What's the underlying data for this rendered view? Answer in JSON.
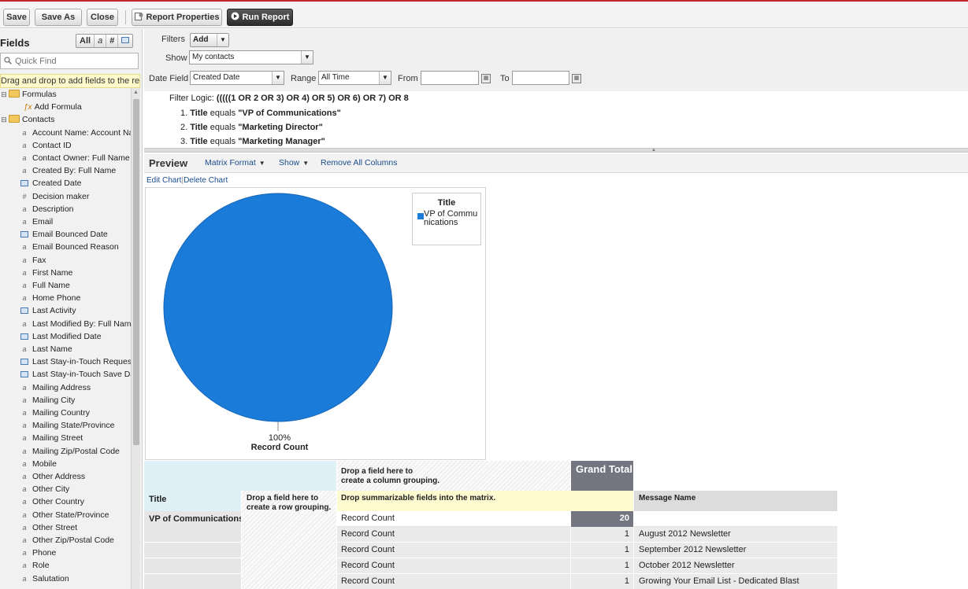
{
  "toolbar": {
    "save": "Save",
    "save_as": "Save As",
    "close": "Close",
    "report_properties": "Report Properties",
    "run_report": "Run Report"
  },
  "fields_panel": {
    "title": "Fields",
    "type_filters": [
      "All",
      "a",
      "#",
      "cal"
    ],
    "quick_find_placeholder": "Quick Find",
    "drag_hint": "Drag and drop to add fields to the report.",
    "tree": [
      {
        "kind": "folder",
        "label": "Formulas",
        "toggle": "⊟"
      },
      {
        "kind": "formula",
        "label": "Add Formula"
      },
      {
        "kind": "folder",
        "label": "Contacts",
        "toggle": "⊟"
      },
      {
        "kind": "text",
        "label": "Account Name: Account Nar"
      },
      {
        "kind": "text",
        "label": "Contact ID"
      },
      {
        "kind": "text",
        "label": "Contact Owner: Full Name"
      },
      {
        "kind": "text",
        "label": "Created By: Full Name"
      },
      {
        "kind": "date",
        "label": "Created Date"
      },
      {
        "kind": "number",
        "label": "Decision maker"
      },
      {
        "kind": "text",
        "label": "Description"
      },
      {
        "kind": "text",
        "label": "Email"
      },
      {
        "kind": "date",
        "label": "Email Bounced Date"
      },
      {
        "kind": "text",
        "label": "Email Bounced Reason"
      },
      {
        "kind": "text",
        "label": "Fax"
      },
      {
        "kind": "text",
        "label": "First Name"
      },
      {
        "kind": "text",
        "label": "Full Name"
      },
      {
        "kind": "text",
        "label": "Home Phone"
      },
      {
        "kind": "date",
        "label": "Last Activity"
      },
      {
        "kind": "text",
        "label": "Last Modified By: Full Name"
      },
      {
        "kind": "date",
        "label": "Last Modified Date"
      },
      {
        "kind": "text",
        "label": "Last Name"
      },
      {
        "kind": "date",
        "label": "Last Stay-in-Touch Request"
      },
      {
        "kind": "date",
        "label": "Last Stay-in-Touch Save Dat"
      },
      {
        "kind": "text",
        "label": "Mailing Address"
      },
      {
        "kind": "text",
        "label": "Mailing City"
      },
      {
        "kind": "text",
        "label": "Mailing Country"
      },
      {
        "kind": "text",
        "label": "Mailing State/Province"
      },
      {
        "kind": "text",
        "label": "Mailing Street"
      },
      {
        "kind": "text",
        "label": "Mailing Zip/Postal Code"
      },
      {
        "kind": "text",
        "label": "Mobile"
      },
      {
        "kind": "text",
        "label": "Other Address"
      },
      {
        "kind": "text",
        "label": "Other City"
      },
      {
        "kind": "text",
        "label": "Other Country"
      },
      {
        "kind": "text",
        "label": "Other State/Province"
      },
      {
        "kind": "text",
        "label": "Other Street"
      },
      {
        "kind": "text",
        "label": "Other Zip/Postal Code"
      },
      {
        "kind": "text",
        "label": "Phone"
      },
      {
        "kind": "text",
        "label": "Role"
      },
      {
        "kind": "text",
        "label": "Salutation"
      }
    ]
  },
  "filters": {
    "filters_label": "Filters",
    "add_label": "Add",
    "show_label": "Show",
    "show_value": "My contacts",
    "date_field_label": "Date Field",
    "date_field_value": "Created Date",
    "range_label": "Range",
    "range_value": "All Time",
    "from_label": "From",
    "from_value": "",
    "to_label": "To",
    "to_value": "",
    "filter_logic_label": "Filter Logic:",
    "filter_logic_value": "(((((1 OR 2 OR 3) OR 4) OR 5) OR 6) OR 7) OR 8",
    "conditions": [
      {
        "num": "1.",
        "field": "Title",
        "op": "equals",
        "value": "\"VP of Communications\""
      },
      {
        "num": "2.",
        "field": "Title",
        "op": "equals",
        "value": "\"Marketing Director\""
      },
      {
        "num": "3.",
        "field": "Title",
        "op": "equals",
        "value": "\"Marketing Manager\""
      }
    ]
  },
  "preview": {
    "title": "Preview",
    "format_label": "Matrix Format",
    "show_label": "Show",
    "remove_columns": "Remove All Columns",
    "edit_chart": "Edit Chart",
    "delete_chart": "Delete Chart"
  },
  "chart_data": {
    "type": "pie",
    "title": "",
    "legend_title": "Title",
    "legend_position": "top-right",
    "slices": [
      {
        "label": "VP of Communications",
        "value": 100,
        "color": "#1a7bd9"
      }
    ],
    "slice_label": "100%",
    "measure_label": "Record Count"
  },
  "matrix": {
    "col_drop_hint": [
      "Drop a field here to",
      "create a column grouping."
    ],
    "grand_total": "Grand Total",
    "row_header": "Title",
    "row_drop_hint": [
      "Drop a field here to",
      "create a row grouping."
    ],
    "summarize_hint": "Drop summarizable fields into the matrix.",
    "message_name_header": "Message Name",
    "group_label": "VP of Communications",
    "rows": [
      {
        "label": "Record Count",
        "value": "20",
        "message": "",
        "summary": true
      },
      {
        "label": "Record Count",
        "value": "1",
        "message": "August 2012 Newsletter",
        "summary": false
      },
      {
        "label": "Record Count",
        "value": "1",
        "message": "September 2012 Newsletter",
        "summary": false
      },
      {
        "label": "Record Count",
        "value": "1",
        "message": "October 2012 Newsletter",
        "summary": false
      },
      {
        "label": "Record Count",
        "value": "1",
        "message": "Growing Your Email List - Dedicated Blast",
        "summary": false
      }
    ]
  },
  "colors": {
    "accent_red": "#c0262c",
    "pie_blue": "#1a7bd9",
    "link_blue": "#1a4c8c",
    "grand_total_bg": "#737580"
  }
}
